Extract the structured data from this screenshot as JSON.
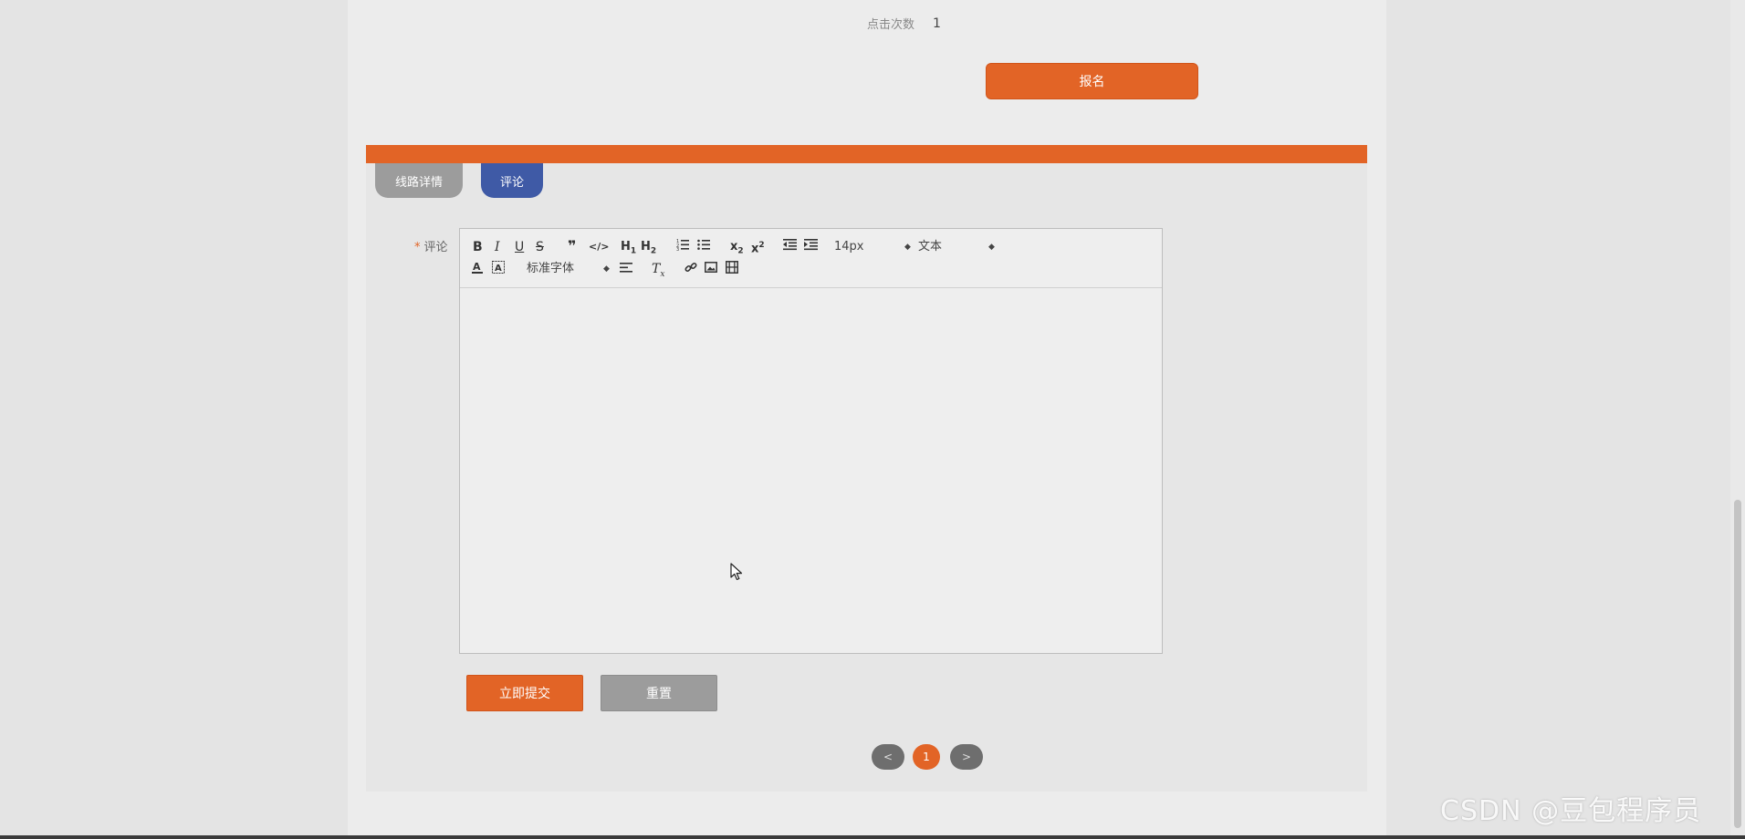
{
  "info": {
    "click_label": "点击次数",
    "click_value": "1"
  },
  "signup_label": "报名",
  "tabs": [
    {
      "label": "线路详情"
    },
    {
      "label": "评论"
    }
  ],
  "form": {
    "comment_label": "评论",
    "required_mark": "*",
    "editor": {
      "font_size": "14px",
      "format": "文本",
      "font_family": "标准字体"
    },
    "submit_label": "立即提交",
    "reset_label": "重置"
  },
  "pager": {
    "prev": "<",
    "current": "1",
    "next": ">"
  },
  "watermark": "CSDN @豆包程序员",
  "colors": {
    "accent": "#e26426",
    "tab_active": "#3f5aa6",
    "tab_inactive": "#9c9c9c"
  }
}
